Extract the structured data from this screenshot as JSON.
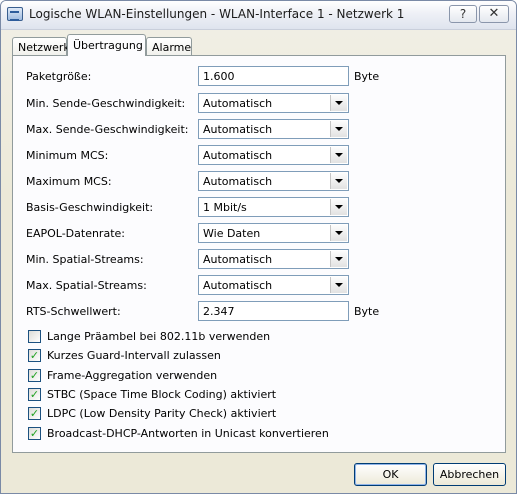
{
  "window": {
    "title": "Logische WLAN-Einstellungen - WLAN-Interface 1 - Netzwerk 1",
    "help_label": "?",
    "close_label": "✕"
  },
  "tabs": [
    {
      "label": "Netzwerk",
      "active": false
    },
    {
      "label": "Übertragung",
      "active": true
    },
    {
      "label": "Alarme",
      "active": false
    }
  ],
  "form": {
    "packet_size": {
      "label": "Paketgröße:",
      "value": "1.600",
      "unit": "Byte"
    },
    "min_send_speed": {
      "label": "Min. Sende-Geschwindigkeit:",
      "value": "Automatisch"
    },
    "max_send_speed": {
      "label": "Max. Sende-Geschwindigkeit:",
      "value": "Automatisch"
    },
    "min_mcs": {
      "label": "Minimum MCS:",
      "value": "Automatisch"
    },
    "max_mcs": {
      "label": "Maximum MCS:",
      "value": "Automatisch"
    },
    "basic_speed": {
      "label": "Basis-Geschwindigkeit:",
      "value": "1 Mbit/s"
    },
    "eapol_rate": {
      "label": "EAPOL-Datenrate:",
      "value": "Wie Daten"
    },
    "min_spatial": {
      "label": "Min. Spatial-Streams:",
      "value": "Automatisch"
    },
    "max_spatial": {
      "label": "Max. Spatial-Streams:",
      "value": "Automatisch"
    },
    "rts_threshold": {
      "label": "RTS-Schwellwert:",
      "value": "2.347",
      "unit": "Byte"
    }
  },
  "options": [
    {
      "label": "Lange Präambel bei 802.11b verwenden",
      "checked": false
    },
    {
      "label": "Kurzes Guard-Intervall zulassen",
      "checked": true
    },
    {
      "label": "Frame-Aggregation verwenden",
      "checked": true
    },
    {
      "label": "STBC (Space Time Block Coding) aktiviert",
      "checked": true
    },
    {
      "label": "LDPC (Low Density Parity Check) aktiviert",
      "checked": true
    },
    {
      "label": "Broadcast-DHCP-Antworten in Unicast konvertieren",
      "checked": true
    }
  ],
  "buttons": {
    "ok": "OK",
    "cancel": "Abbrechen"
  },
  "check_mark": "✓"
}
